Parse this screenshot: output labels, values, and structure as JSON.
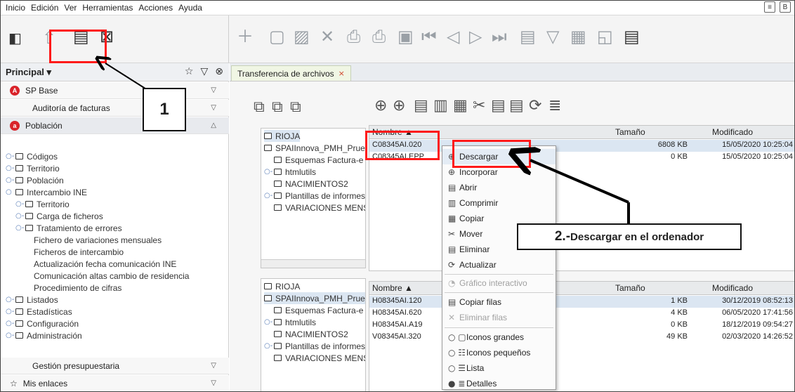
{
  "menubar": {
    "items": [
      "Inicio",
      "Edición",
      "Ver",
      "Herramientas",
      "Acciones",
      "Ayuda"
    ],
    "right_text": "B"
  },
  "left_panel": {
    "header": "Principal ▾",
    "sections": [
      {
        "label": "SP Base",
        "badge": "A"
      },
      {
        "label": "Auditoría de facturas"
      },
      {
        "label": "Población",
        "badge": "a"
      }
    ],
    "tree": [
      {
        "label": "Códigos",
        "depth": 0,
        "expander": "○-"
      },
      {
        "label": "Territorio",
        "depth": 0,
        "expander": "○-"
      },
      {
        "label": "Población",
        "depth": 0,
        "expander": "○-"
      },
      {
        "label": "Intercambio INE",
        "depth": 0,
        "expander": "○"
      },
      {
        "label": "Territorio",
        "depth": 1,
        "expander": "○-"
      },
      {
        "label": "Carga de ficheros",
        "depth": 1,
        "expander": "○-"
      },
      {
        "label": "Tratamiento de errores",
        "depth": 1,
        "expander": "○-"
      },
      {
        "label": "Fichero de variaciones mensuales",
        "depth": 2
      },
      {
        "label": "Ficheros de intercambio",
        "depth": 2
      },
      {
        "label": "Actualización fecha comunicación INE",
        "depth": 2
      },
      {
        "label": "Comunicación altas cambio de residencia",
        "depth": 2
      },
      {
        "label": "Procedimiento de cifras",
        "depth": 2
      },
      {
        "label": "Listados",
        "depth": 0,
        "expander": "○-"
      },
      {
        "label": "Estadísticas",
        "depth": 0,
        "expander": "○-"
      },
      {
        "label": "Configuración",
        "depth": 0,
        "expander": "○-"
      },
      {
        "label": "Administración",
        "depth": 0,
        "expander": "○-"
      }
    ],
    "bottom_sections": [
      {
        "label": "Gestión presupuestaria"
      },
      {
        "label": "Mis enlaces"
      }
    ]
  },
  "tab": {
    "label": "Transferencia de archivos",
    "close": "×"
  },
  "folder_tree_top": [
    "RIOJA",
    "SPAIInnova_PMH_Prueba",
    "Esquemas Factura-e",
    "htmlutils",
    "NACIMIENTOS2",
    "Plantillas de informes",
    "VARIACIONES MENSU"
  ],
  "folder_tree_bottom": [
    "RIOJA",
    "SPAIInnova_PMH_Prueba",
    "Esquemas Factura-e",
    "htmlutils",
    "NACIMIENTOS2",
    "Plantillas de informes",
    "VARIACIONES MENSU"
  ],
  "table_top": {
    "headers": {
      "name": "Nombre ▲",
      "size": "Tamaño",
      "modified": "Modificado"
    },
    "rows": [
      {
        "name": "C08345AI.020",
        "size": "6808 KB",
        "modified": "15/05/2020 10:25:04"
      },
      {
        "name": "C08345AI.EPP",
        "size": "0 KB",
        "modified": "15/05/2020 10:25:04"
      }
    ]
  },
  "table_bottom": {
    "headers": {
      "name": "Nombre ▲",
      "size": "Tamaño",
      "modified": "Modificado"
    },
    "rows": [
      {
        "name": "H08345AI.120",
        "size": "1 KB",
        "modified": "30/12/2019 08:52:13"
      },
      {
        "name": "H08345AI.620",
        "size": "4 KB",
        "modified": "06/05/2020 17:41:56"
      },
      {
        "name": "H08345AI.A19",
        "size": "0 KB",
        "modified": "18/12/2019 09:54:27"
      },
      {
        "name": "V08345AI.320",
        "size": "49 KB",
        "modified": "02/03/2020 14:26:52"
      }
    ]
  },
  "context_menu": {
    "items": [
      {
        "label": "Descargar",
        "icon": "globe-down-icon"
      },
      {
        "label": "Incorporar",
        "icon": "globe-up-icon"
      },
      {
        "label": "Abrir",
        "icon": "open-icon"
      },
      {
        "label": "Comprimir",
        "icon": "compress-icon"
      },
      {
        "label": "Copiar",
        "icon": "copy-icon"
      },
      {
        "label": "Mover",
        "icon": "move-icon"
      },
      {
        "label": "Eliminar",
        "icon": "delete-icon"
      },
      {
        "label": "Actualizar",
        "icon": "refresh-icon"
      },
      {
        "label": "Gráfico interactivo",
        "icon": "chart-icon",
        "disabled": true
      },
      {
        "label": "Copiar filas",
        "icon": "copy-rows-icon"
      },
      {
        "label": "Eliminar filas",
        "icon": "delete-rows-icon",
        "disabled": true
      },
      {
        "label": "Iconos grandes",
        "icon": "large-icons-icon"
      },
      {
        "label": "Iconos pequeños",
        "icon": "small-icons-icon"
      },
      {
        "label": "Lista",
        "icon": "list-icon"
      },
      {
        "label": "Detalles",
        "icon": "details-icon"
      }
    ]
  },
  "annotations": {
    "callout1": "1",
    "callout2_number": "2.-",
    "callout2_text": " Descargar en el ordenador"
  },
  "colors": {
    "annotation_red": "#ff1a1a",
    "badge_red": "#d9232a",
    "tab_close": "#d0452a"
  }
}
